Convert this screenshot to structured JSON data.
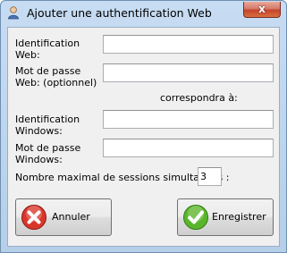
{
  "window": {
    "title": "Ajouter une authentification Web",
    "close_glyph": "x"
  },
  "form": {
    "web_id_label": "Identification\nWeb:",
    "web_id_value": "",
    "web_pwd_label": "Mot de passe\nWeb: (optionnel)",
    "web_pwd_value": "",
    "corresponds_text": "correspondra à:",
    "win_id_label": "Identification\nWindows:",
    "win_id_value": "",
    "win_pwd_label": "Mot de passe\nWindows:",
    "win_pwd_value": "",
    "max_sessions_label": "Nombre maximal de sessions simultanées :",
    "max_sessions_value": "3"
  },
  "buttons": {
    "cancel_label": "Annuler",
    "cancel_icon": "red-x-circle-icon",
    "save_label": "Enregistrer",
    "save_icon": "green-check-circle-icon"
  },
  "colors": {
    "cancel_icon": "#d9362b",
    "save_icon": "#5bb52c"
  }
}
